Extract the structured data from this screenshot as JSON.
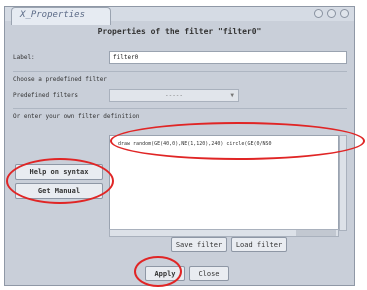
{
  "window": {
    "tab_title": "X_Properties",
    "heading": "Properties of the filter \"filter0\""
  },
  "form": {
    "label_caption": "Label:",
    "label_value": "filter0",
    "predefined_section": "Choose a predefined filter",
    "predefined_caption": "Predefined filters",
    "predefined_selected": "-----",
    "own_section": "Or enter your own filter definition",
    "definition_text": "draw random(GE(40,0),NE(1,120),240) circle(GE(0/NS0"
  },
  "buttons": {
    "help_syntax": "Help on syntax",
    "get_manual": "Get Manual",
    "save_filter": "Save filter",
    "load_filter": "Load filter",
    "apply": "Apply",
    "close": "Close"
  },
  "colors": {
    "annotation": "#e02525",
    "window_bg": "#c9cfd9"
  }
}
